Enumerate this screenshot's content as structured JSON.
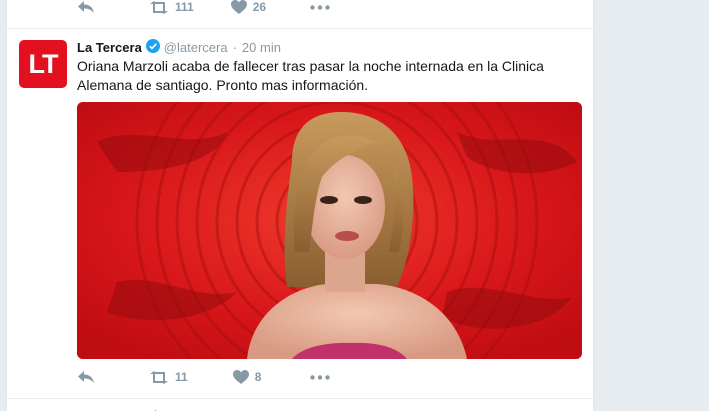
{
  "prev_tweet": {
    "actions": {
      "reply_icon": "reply-icon",
      "retweet_icon": "retweet-icon",
      "retweet_count": "111",
      "like_icon": "heart-icon",
      "like_count": "26",
      "more_icon": "more-icon"
    }
  },
  "tweet": {
    "avatar_text": "LT",
    "name": "La Tercera",
    "verified_icon": "verified-badge-icon",
    "handle": "@latercera",
    "separator": "·",
    "time": "20 min",
    "text": "Oriana Marzoli acaba de fallecer tras pasar la noche internada en la Clinica Alemana de santiago. Pronto mas información.",
    "media_description": "photo-woman-red-background",
    "actions": {
      "reply_icon": "reply-icon",
      "retweet_icon": "retweet-icon",
      "retweet_count": "11",
      "like_icon": "heart-icon",
      "like_count": "8",
      "more_icon": "more-icon"
    }
  },
  "colors": {
    "brand_red": "#e3101f",
    "verified_blue": "#1da1f2",
    "muted": "#8899a6",
    "text": "#14171a",
    "page_bg": "#e6ecf0",
    "retweet_green": "#17bf63"
  }
}
